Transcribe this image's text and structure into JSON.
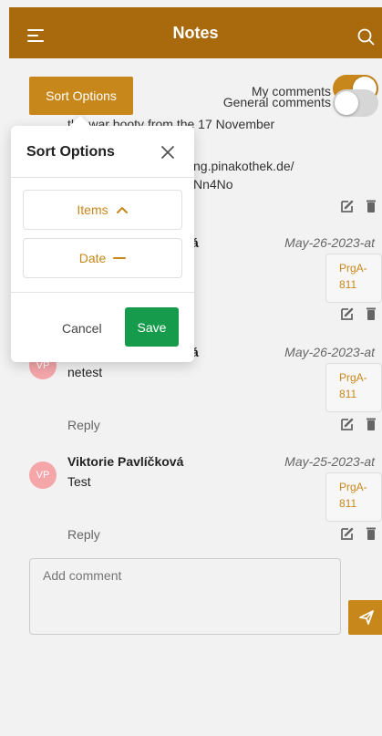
{
  "header": {
    "title": "Notes",
    "bg_color": "#a86a0c",
    "menu_icon": "hamburger-menu-icon",
    "search_icon": "search-icon"
  },
  "toolbar": {
    "sort_button_label": "Sort Options",
    "my_comments_label": "My comments",
    "general_comments_label": "General comments",
    "my_comments_on": true,
    "general_comments_on": false
  },
  "background_text": {
    "line1": "the war booty from the 17 November",
    "line2": "ng.pinakothek.de/",
    "line3": "Nn4No"
  },
  "comments": [
    {
      "name_partial": "á",
      "date": "May-26-2023-at",
      "tag_line1": "PrgA-",
      "tag_line2": "811"
    },
    {
      "avatar": "VP",
      "name_partial": "á",
      "date": "May-26-2023-at",
      "text": "netest",
      "tag_line1": "PrgA-",
      "tag_line2": "811",
      "reply_label": "Reply"
    },
    {
      "avatar": "VP",
      "name": "Viktorie Pavlíčková",
      "date": "May-25-2023-at",
      "text": "Test",
      "tag_line1": "PrgA-",
      "tag_line2": "811",
      "reply_label": "Reply"
    }
  ],
  "add_comment": {
    "placeholder": "Add comment"
  },
  "sort_popup": {
    "title": "Sort Options",
    "items": [
      {
        "label": "Items",
        "indicator": "chevron-up-icon"
      },
      {
        "label": "Date",
        "indicator": "dash-icon"
      }
    ],
    "cancel_label": "Cancel",
    "save_label": "Save"
  },
  "colors": {
    "accent": "#c8871a",
    "save_green": "#169a4c",
    "avatar_pink": "#f4a6a9"
  }
}
